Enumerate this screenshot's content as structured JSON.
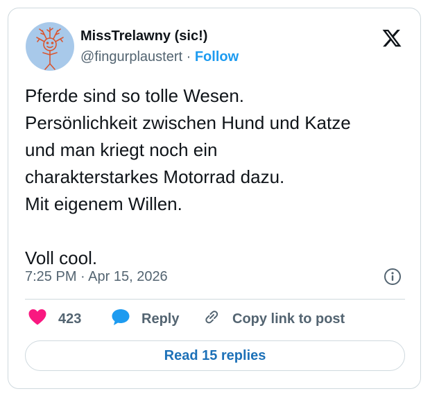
{
  "author": {
    "display_name": "MissTrelawny (sic!)",
    "handle": "@fingurplaustert",
    "separator": "·",
    "follow_label": "Follow",
    "avatar_bg": "#a8c9ea",
    "avatar_drawing_color": "#d9552f"
  },
  "brand": {
    "logo_icon": "x-logo-icon"
  },
  "tweet": {
    "text": "Pferde sind so tolle Wesen.\nPersönlichkeit zwischen Hund und Katze\nund man kriegt noch ein\ncharakterstarkes Motorrad dazu.\nMit eigenem Willen.\n\nVoll cool.",
    "timestamp": "7:25 PM · Apr 15, 2026",
    "info_icon": "info-icon"
  },
  "actions": {
    "like_count": "423",
    "reply_label": "Reply",
    "copy_link_label": "Copy link to post",
    "like_color": "#f91880",
    "reply_color": "#1d9bf0"
  },
  "footer": {
    "read_replies_label": "Read 15 replies"
  },
  "colors": {
    "accent": "#1d9bf0",
    "border": "#cfd9de",
    "muted_text": "#536471",
    "text": "#0f1419"
  }
}
